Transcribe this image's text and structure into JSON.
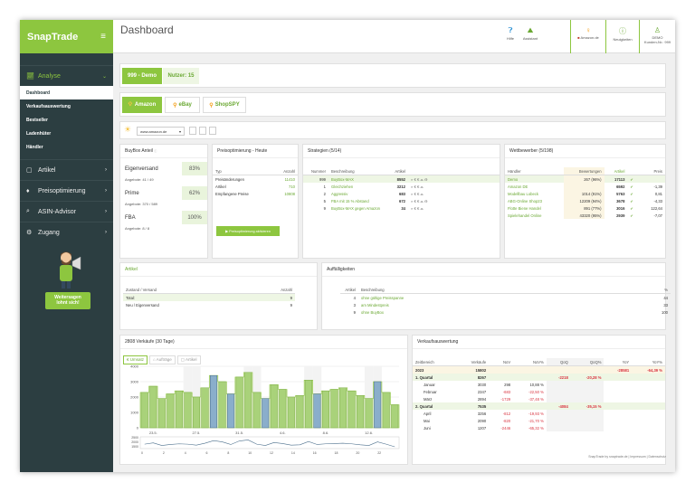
{
  "app": {
    "brand": "SnapTrade",
    "page_title": "Dashboard",
    "footer": "SnapTrade by snaptrade.de | Impressum | Datenschutz"
  },
  "sidebar": {
    "groups": [
      {
        "label": "Analyse",
        "icon": "chart-icon"
      },
      {
        "label": "Artikel",
        "icon": "bag-icon"
      },
      {
        "label": "Preisoptimierung",
        "icon": "tag-icon"
      },
      {
        "label": "ASIN-Advisor",
        "icon": "search-icon"
      },
      {
        "label": "Zugang",
        "icon": "gear-icon"
      }
    ],
    "sub_items": [
      "Dashboard",
      "Verkaufsauswertung",
      "Bestseller",
      "Ladenhüter",
      "Händler"
    ],
    "promo": {
      "line1": "Weitersagen",
      "line2": "lohnt sich!"
    }
  },
  "topbar": {
    "help": "Hilfe",
    "assistant": "Assistant",
    "amazon": "Amazon.de",
    "news": "Neuigkeiten",
    "demo": "DEMO",
    "customer": "Kunden-Nr.: 999"
  },
  "account": {
    "id_label": "999 - Demo",
    "users": "Nutzer: 15"
  },
  "marketplaces": [
    "Amazon",
    "eBay",
    "ShopSPY"
  ],
  "filter": {
    "marketplace": "www.amazon.de"
  },
  "buybox": {
    "title": "BuyBox Anteil",
    "rows": [
      {
        "label": "Eigenversand",
        "pct": "83%",
        "sub": "Angebote: 41 / 49"
      },
      {
        "label": "Prime",
        "pct": "62%",
        "sub": "Angebote: 370 / 589"
      },
      {
        "label": "FBA",
        "pct": "100%",
        "sub": "Angebote: 8 / 8"
      }
    ]
  },
  "preisopt": {
    "title": "Preisoptimierung - Heute",
    "col_type": "Typ",
    "col_count": "Anzahl",
    "rows": [
      {
        "type": "Preisänderungen",
        "count": "11410"
      },
      {
        "type": "Artikel",
        "count": "710"
      },
      {
        "type": "Empfangene Preise",
        "count": "10808"
      }
    ],
    "button": "Preisoptimierung aktivieren"
  },
  "strategies": {
    "title": "Strategien (5/14)",
    "col_num": "Nummer",
    "col_desc": "Beschreibung",
    "col_art": "Artikel",
    "rows": [
      {
        "num": "999",
        "desc": "BuyBox-MAX",
        "art": "8552"
      },
      {
        "num": "1",
        "desc": "Gleichziehen",
        "art": "3212"
      },
      {
        "num": "2",
        "desc": "Aggressiv",
        "art": "683"
      },
      {
        "num": "5",
        "desc": "FBA mit 15 % Abstand",
        "art": "672"
      },
      {
        "num": "9",
        "desc": "BuyBox-MAX gegen Amazon",
        "art": "34"
      }
    ]
  },
  "competitors": {
    "title": "Wettbewerber (5/198)",
    "col_h": "Händler",
    "col_b": "Bewertungen",
    "col_a": "Artikel",
    "col_p": "Preis",
    "rows": [
      {
        "name": "Demo",
        "rating": "267 (96%)",
        "art": "17113",
        "price": ""
      },
      {
        "name": "Amazon DE",
        "rating": "",
        "art": "6592",
        "price": "-1,39"
      },
      {
        "name": "Modellbau Lobeck",
        "rating": "1014 (91%)",
        "art": "5763",
        "price": "0,81"
      },
      {
        "name": "ABG-Online Shop23",
        "rating": "12209 (94%)",
        "art": "3678",
        "price": "-4,33"
      },
      {
        "name": "Flotte Biene Handel",
        "rating": "891 (77%)",
        "art": "3016",
        "price": "122,64"
      },
      {
        "name": "Spielehandel Online",
        "rating": "43320 (95%)",
        "art": "2939",
        "price": "-7,07"
      }
    ]
  },
  "artikel": {
    "title": "Artikel",
    "col_z": "Zustand / Versand",
    "col_a": "Anzahl",
    "rows": [
      {
        "z": "Total:",
        "a": "9"
      },
      {
        "z": "Neu / Eigenversand",
        "a": "9"
      }
    ]
  },
  "auffaellig": {
    "title": "Auffälligkeiten",
    "col_a": "Artikel",
    "col_b": "Beschreibung",
    "col_p": "%",
    "rows": [
      {
        "a": "4",
        "b": "ohne gültige Preisspanne",
        "p": "44"
      },
      {
        "a": "3",
        "b": "am Mindestpreis",
        "p": "33"
      },
      {
        "a": "9",
        "b": "ohne BuyBox",
        "p": "100"
      }
    ]
  },
  "sales_chart": {
    "title": "2808 Verkäufe (30 Tage)",
    "tabs": [
      "Umsatz",
      "Aufträge",
      "Artikel"
    ]
  },
  "chart_data": {
    "type": "bar",
    "ylim": [
      0,
      4000
    ],
    "yticks": [
      "4000",
      "3000",
      "2000",
      "1000",
      "0"
    ],
    "xlabels": [
      "23.5.",
      "27.5.",
      "31.5.",
      "4.6.",
      "8.6.",
      "12.6."
    ],
    "values": [
      2300,
      2700,
      1900,
      2200,
      2400,
      2300,
      2000,
      2600,
      3400,
      3000,
      2200,
      3300,
      3600,
      2300,
      1900,
      2800,
      2500,
      2000,
      2100,
      3100,
      2200,
      2400,
      2500,
      2600,
      2400,
      2100,
      1900,
      3000,
      2300,
      1500
    ],
    "highlighted": [
      8,
      10,
      14,
      20,
      27
    ],
    "overview_xlabels": [
      "0",
      "2",
      "4",
      "6",
      "8",
      "10",
      "12",
      "14",
      "16",
      "18",
      "20",
      "22"
    ]
  },
  "verkauf": {
    "title": "Verkaufsauswertung",
    "cols": [
      "Zeitbereich",
      "Verkäufe",
      "NoV",
      "NoV%",
      "QoQ",
      "QoQ%",
      "YoY",
      "YoY%"
    ],
    "rows": [
      {
        "c": [
          "2023",
          "15802",
          "",
          "",
          "",
          "",
          "-28581",
          "-64,39 %"
        ],
        "t": "y"
      },
      {
        "c": [
          "1. Quartal",
          "8267",
          "",
          "",
          "-2218",
          "-20,28 %",
          "",
          ""
        ],
        "t": "g"
      },
      {
        "c": [
          "Januar",
          "3030",
          "298",
          "10,88 %",
          "",
          "",
          "",
          ""
        ],
        "t": "s"
      },
      {
        "c": [
          "Februar",
          "2347",
          "-683",
          "-22,50 %",
          "",
          "",
          "",
          ""
        ],
        "t": "s"
      },
      {
        "c": [
          "März",
          "2894",
          "-1729",
          "-37,48 %",
          "",
          "",
          "",
          ""
        ],
        "t": "s"
      },
      {
        "c": [
          "2. Quartal",
          "7535",
          "",
          "",
          "-4084",
          "-35,15 %",
          "",
          ""
        ],
        "t": "g"
      },
      {
        "c": [
          "April",
          "3256",
          "-812",
          "-19,93 %",
          "",
          "",
          "",
          ""
        ],
        "t": "s"
      },
      {
        "c": [
          "Mai",
          "2090",
          "-820",
          "-21,70 %",
          "",
          "",
          "",
          ""
        ],
        "t": "s"
      },
      {
        "c": [
          "Juni",
          "1207",
          "-2446",
          "-65,32 %",
          "",
          "",
          "",
          ""
        ],
        "t": "s"
      }
    ]
  }
}
